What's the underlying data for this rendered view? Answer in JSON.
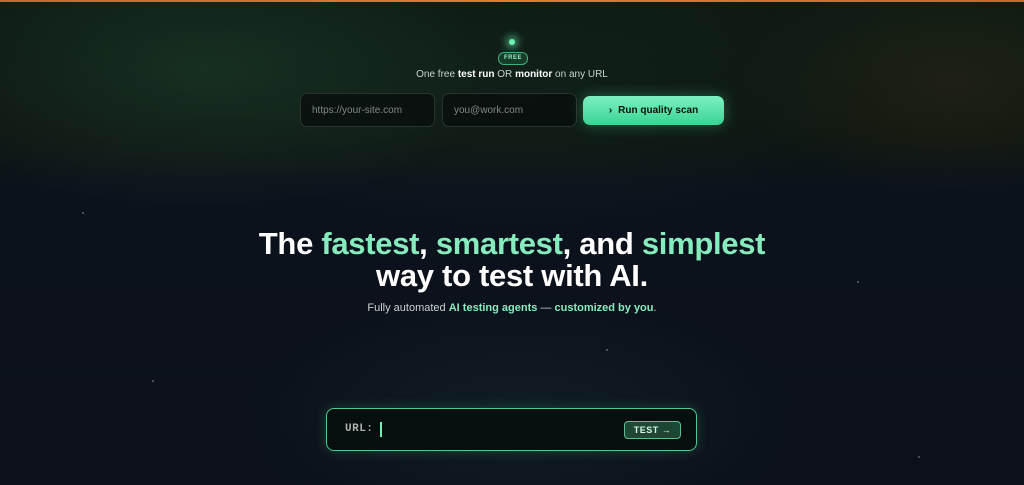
{
  "promo": {
    "badge": "FREE",
    "offer_prefix": "One free ",
    "offer_bold_1": "test run",
    "offer_mid": " OR ",
    "offer_bold_2": "monitor",
    "offer_suffix": " on any URL"
  },
  "scan_form": {
    "url_placeholder": "https://your-site.com",
    "email_placeholder": "you@work.com",
    "button_icon": "›",
    "button_label": "Run quality scan"
  },
  "hero": {
    "line1_prefix": "The ",
    "accent_1": "fastest",
    "sep_1": ", ",
    "accent_2": "smartest",
    "sep_2": ", and ",
    "accent_3": "simplest",
    "line2": "way to test with AI.",
    "sub_prefix": "Fully automated ",
    "sub_accent_1": "AI testing agents",
    "sub_mid": " — ",
    "sub_accent_2": "customized by you",
    "sub_suffix": "."
  },
  "terminal": {
    "label": "URL:",
    "input_value": "",
    "button_label": "TEST →"
  },
  "colors": {
    "accent": "#86ecbd",
    "button_green": "#39d494",
    "top_bar": "#e07a33",
    "background": "#0b1018"
  }
}
